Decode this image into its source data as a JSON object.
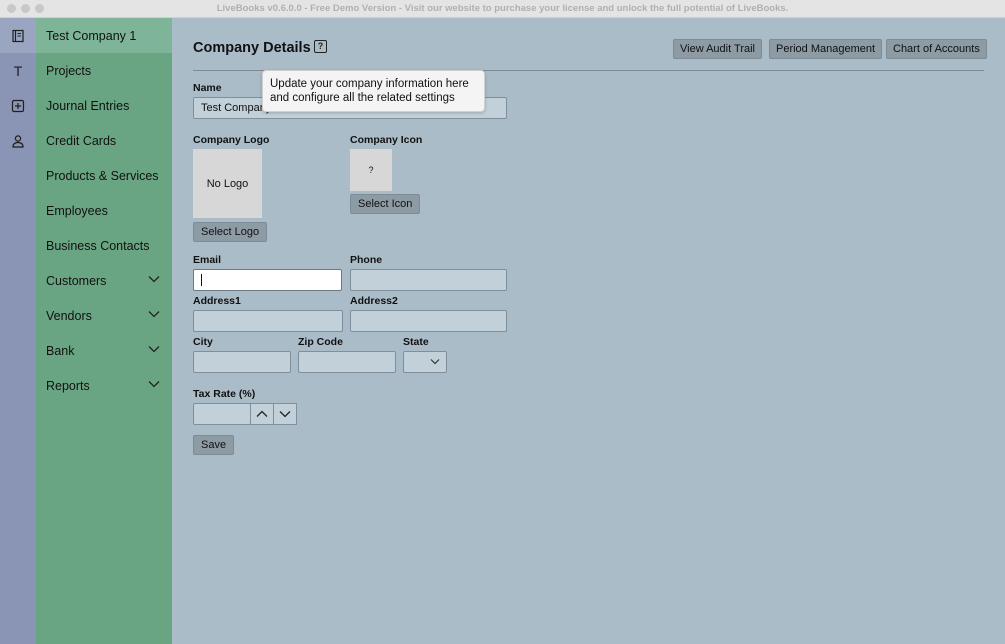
{
  "window": {
    "title": "LiveBooks v0.6.0.0 - Free Demo Version - Visit our website to purchase your license and unlock the full potential of LiveBooks."
  },
  "rail": {
    "items": [
      {
        "name": "book-icon",
        "active": true
      },
      {
        "name": "company-letter",
        "label": "T",
        "active": false
      },
      {
        "name": "add-icon",
        "active": false
      },
      {
        "name": "user-icon",
        "active": false
      }
    ]
  },
  "sidebar": {
    "items": [
      {
        "label": "Test Company 1",
        "active": true
      },
      {
        "label": "Projects"
      },
      {
        "label": "Journal Entries"
      },
      {
        "label": "Credit Cards"
      },
      {
        "label": "Products & Services"
      },
      {
        "label": "Employees"
      },
      {
        "label": "Business Contacts"
      },
      {
        "label": "Customers",
        "expandable": true
      },
      {
        "label": "Vendors",
        "expandable": true
      },
      {
        "label": "Bank",
        "expandable": true
      },
      {
        "label": "Reports",
        "expandable": true
      }
    ]
  },
  "header": {
    "title": "Company Details",
    "help_icon": "?",
    "buttons": {
      "audit": "View Audit Trail",
      "period": "Period Management",
      "accounts": "Chart of Accounts"
    }
  },
  "tooltip": {
    "line1": "Update your company information here",
    "line2": "and configure all the related settings"
  },
  "form": {
    "name_label": "Name",
    "name_value": "Test Company 1",
    "logo_label": "Company Logo",
    "logo_placeholder": "No Logo",
    "select_logo": "Select Logo",
    "icon_label": "Company Icon",
    "icon_placeholder": "?",
    "select_icon": "Select Icon",
    "email_label": "Email",
    "email_value": "",
    "phone_label": "Phone",
    "phone_value": "",
    "address1_label": "Address1",
    "address1_value": "",
    "address2_label": "Address2",
    "address2_value": "",
    "city_label": "City",
    "city_value": "",
    "zip_label": "Zip Code",
    "zip_value": "",
    "state_label": "State",
    "state_value": "",
    "tax_label": "Tax Rate (%)",
    "tax_value": "",
    "save_label": "Save"
  },
  "colors": {
    "rail": "#8a95b5",
    "sidebar": "#6aa583",
    "sidebar_active": "#7eb498",
    "content": "#a9bcc8",
    "button": "#8d9ba5"
  }
}
